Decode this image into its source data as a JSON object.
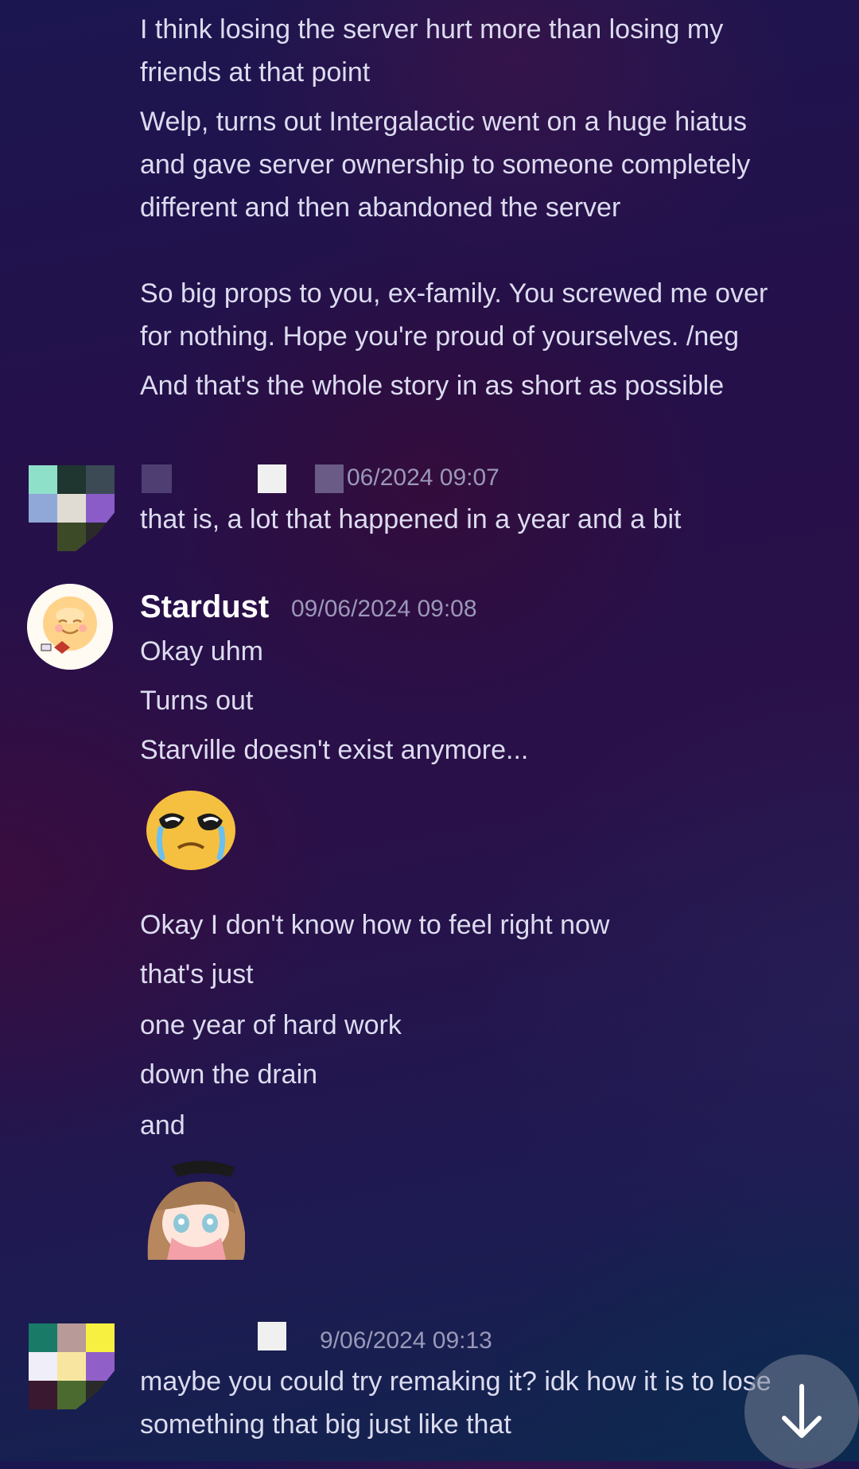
{
  "messages": {
    "top_lines": [
      "I think losing the server hurt more than losing my",
      "friends at that point",
      "Welp, turns out Intergalactic went on a huge hiatus",
      "and gave server ownership to someone completely",
      "different and then abandoned the server",
      "So big props to you, ex-family. You screwed me over",
      "for nothing. Hope you're proud of yourselves. /neg",
      "And that's the whole story in as short as possible"
    ],
    "msg2": {
      "timestamp": "06/2024 09:07",
      "text": "that is, a lot that happened in a year and a bit"
    },
    "msg3": {
      "author": "Stardust",
      "timestamp": "09/06/2024 09:08",
      "lines": [
        "Okay uhm",
        "Turns out",
        "Starville doesn't exist anymore...",
        "Okay I don't know how to feel right now",
        "that's just",
        "one year of hard work",
        "down the drain",
        "and"
      ]
    },
    "msg4": {
      "timestamp": "9/06/2024 09:13",
      "lines": [
        "maybe you could try remaking it? idk how it is to lose",
        "something that big just like that"
      ]
    }
  },
  "icons": {
    "scroll_down": "arrow-down-icon",
    "emoji_crying": "crying-emoji-icon",
    "sticker": "crying-anime-girl-sticker"
  },
  "colors": {
    "text": "#dcdcf0",
    "timestamp": "#9a98b8",
    "author": "#ffffff"
  }
}
